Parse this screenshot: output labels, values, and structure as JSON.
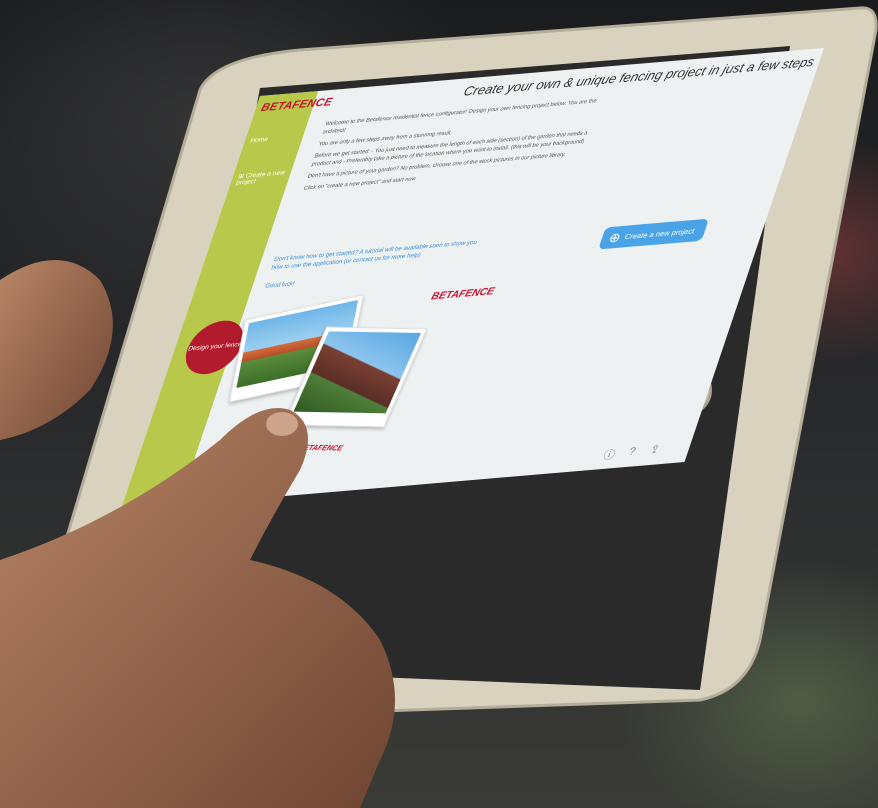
{
  "app": {
    "logo": "BETAFENCE",
    "headline": "Create your own & unique fencing project in just a few steps"
  },
  "sidebar": {
    "items": [
      {
        "label": "Home"
      },
      {
        "label": "Create a new project"
      }
    ]
  },
  "intro": {
    "lines": [
      "Welcome to the Betafence residential fence configurator! Design your own fencing project below. You are the architect!",
      "You are only a few steps away from a stunning result.",
      "Before we get started: - You just need to measure the length of each side (section) of the garden that needs a product and - Preferably take a picture of the location where you want to install. (this will be your background)",
      "Don't have a picture of your garden? No problem, choose one of the stock pictures in our picture library.",
      "Click on \"create a new project\" and start now"
    ]
  },
  "help": {
    "text": "Don't know how to get started? A tutorial will be available soon to show you how to use the application (or contact us for more help)",
    "good_luck": "Good luck!"
  },
  "actions": {
    "create_label": "Create a new project"
  },
  "promo": {
    "brand": "BETAFENCE",
    "badge": "Design your fence",
    "brand_small": "BETAFENCE"
  },
  "colors": {
    "brand_red": "#c8102e",
    "sidebar_green": "#b8c84a",
    "button_blue": "#4aa3e6"
  }
}
